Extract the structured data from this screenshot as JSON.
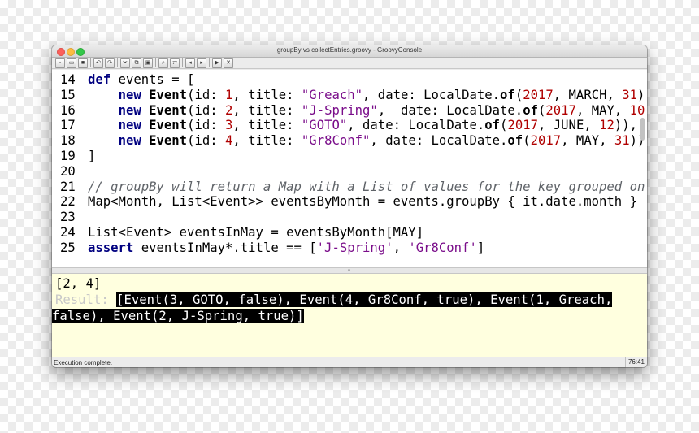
{
  "window": {
    "title": "groupBy vs collectEntries.groovy - GroovyConsole"
  },
  "toolbar": {
    "buttons": [
      "new-file-icon",
      "open-icon",
      "save-icon",
      "undo-icon",
      "redo-icon",
      "cut-icon",
      "copy-icon",
      "paste-icon",
      "find-icon",
      "replace-icon",
      "history-previous-icon",
      "history-next-icon",
      "run-icon",
      "interrupt-icon"
    ]
  },
  "editor": {
    "lines": [
      {
        "n": "14",
        "parts": [
          [
            "kw",
            "def"
          ],
          [
            "p",
            " events = ["
          ]
        ]
      },
      {
        "n": "15",
        "parts": [
          [
            "p",
            "    "
          ],
          [
            "kw",
            "new"
          ],
          [
            "p",
            " "
          ],
          [
            "cls",
            "Event"
          ],
          [
            "p",
            "(id: "
          ],
          [
            "num",
            "1"
          ],
          [
            "p",
            ", title: "
          ],
          [
            "str",
            "\"Greach\""
          ],
          [
            "p",
            ", date: LocalDate."
          ],
          [
            "cls",
            "of"
          ],
          [
            "p",
            "("
          ],
          [
            "num",
            "2017"
          ],
          [
            "p",
            ", MARCH, "
          ],
          [
            "num",
            "31"
          ],
          [
            "p",
            ")),"
          ]
        ]
      },
      {
        "n": "16",
        "parts": [
          [
            "p",
            "    "
          ],
          [
            "kw",
            "new"
          ],
          [
            "p",
            " "
          ],
          [
            "cls",
            "Event"
          ],
          [
            "p",
            "(id: "
          ],
          [
            "num",
            "2"
          ],
          [
            "p",
            ", title: "
          ],
          [
            "str",
            "\"J-Spring\""
          ],
          [
            "p",
            ",  date: LocalDate."
          ],
          [
            "cls",
            "of"
          ],
          [
            "p",
            "("
          ],
          [
            "num",
            "2017"
          ],
          [
            "p",
            ", MAY, "
          ],
          [
            "num",
            "10"
          ],
          [
            "p",
            "))"
          ]
        ]
      },
      {
        "n": "17",
        "parts": [
          [
            "p",
            "    "
          ],
          [
            "kw",
            "new"
          ],
          [
            "p",
            " "
          ],
          [
            "cls",
            "Event"
          ],
          [
            "p",
            "(id: "
          ],
          [
            "num",
            "3"
          ],
          [
            "p",
            ", title: "
          ],
          [
            "str",
            "\"GOTO\""
          ],
          [
            "p",
            ", date: LocalDate."
          ],
          [
            "cls",
            "of"
          ],
          [
            "p",
            "("
          ],
          [
            "num",
            "2017"
          ],
          [
            "p",
            ", JUNE, "
          ],
          [
            "num",
            "12"
          ],
          [
            "p",
            ")),"
          ]
        ]
      },
      {
        "n": "18",
        "parts": [
          [
            "p",
            "    "
          ],
          [
            "kw",
            "new"
          ],
          [
            "p",
            " "
          ],
          [
            "cls",
            "Event"
          ],
          [
            "p",
            "(id: "
          ],
          [
            "num",
            "4"
          ],
          [
            "p",
            ", title: "
          ],
          [
            "str",
            "\"Gr8Conf\""
          ],
          [
            "p",
            ", date: LocalDate."
          ],
          [
            "cls",
            "of"
          ],
          [
            "p",
            "("
          ],
          [
            "num",
            "2017"
          ],
          [
            "p",
            ", MAY, "
          ],
          [
            "num",
            "31"
          ],
          [
            "p",
            "))"
          ]
        ]
      },
      {
        "n": "19",
        "parts": [
          [
            "p",
            "]"
          ]
        ]
      },
      {
        "n": "20",
        "parts": []
      },
      {
        "n": "21",
        "parts": [
          [
            "cmt",
            "// groupBy will return a Map with a List of values for the key grouped on"
          ]
        ]
      },
      {
        "n": "22",
        "parts": [
          [
            "p",
            "Map<Month, List<Event>> eventsByMonth = events.groupBy { it.date.month }"
          ]
        ]
      },
      {
        "n": "23",
        "parts": []
      },
      {
        "n": "24",
        "parts": [
          [
            "p",
            "List<Event> eventsInMay = eventsByMonth[MAY]"
          ]
        ]
      },
      {
        "n": "25",
        "parts": [
          [
            "kw",
            "assert"
          ],
          [
            "p",
            " eventsInMay*.title == ["
          ],
          [
            "str",
            "'J-Spring'"
          ],
          [
            "p",
            ", "
          ],
          [
            "str",
            "'Gr8Conf'"
          ],
          [
            "p",
            "]"
          ]
        ]
      }
    ]
  },
  "output": {
    "line1": "[2, 4]",
    "result_label": "Result: ",
    "result_line1": "[Event(3, GOTO, false), Event(4, Gr8Conf, true), Event(1, Greach,",
    "result_line2": "false), Event(2, J-Spring, true)]"
  },
  "status": {
    "message": "Execution complete.",
    "position": "76:41"
  }
}
